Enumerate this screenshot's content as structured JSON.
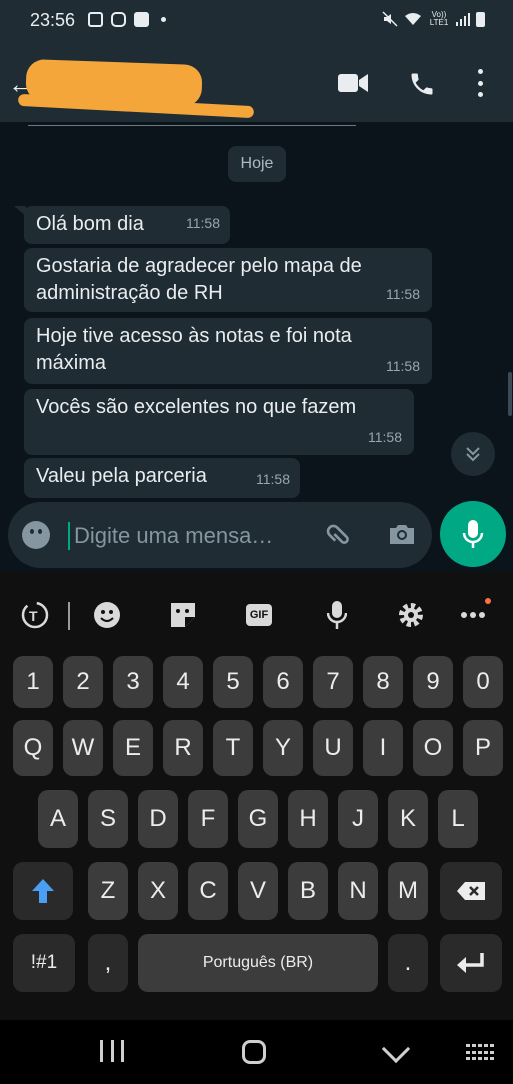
{
  "status_bar": {
    "time": "23:56",
    "network_label": "Vo)) LTE1"
  },
  "app_bar": {
    "contact_name": "",
    "icons": [
      "back-arrow-icon",
      "video-call-icon",
      "phone-call-icon",
      "more-vert-icon"
    ]
  },
  "chat": {
    "date_label": "Hoje",
    "messages": [
      {
        "text": "Olá bom dia",
        "time": "11:58"
      },
      {
        "text": "Gostaria de agradecer pelo mapa de administração de RH",
        "time": "11:58"
      },
      {
        "text": "Hoje tive acesso às notas e foi nota máxima",
        "time": "11:58"
      },
      {
        "text": "Vocês são excelentes no que fazem",
        "time": "11:58"
      },
      {
        "text": "Valeu pela parceria",
        "time": "11:58"
      }
    ]
  },
  "composer": {
    "placeholder": "Digite uma mensa…"
  },
  "keyboard": {
    "number_row": [
      "1",
      "2",
      "3",
      "4",
      "5",
      "6",
      "7",
      "8",
      "9",
      "0"
    ],
    "row1": [
      "Q",
      "W",
      "E",
      "R",
      "T",
      "Y",
      "U",
      "I",
      "O",
      "P"
    ],
    "row2": [
      "A",
      "S",
      "D",
      "F",
      "G",
      "H",
      "J",
      "K",
      "L"
    ],
    "row3": [
      "Z",
      "X",
      "C",
      "V",
      "B",
      "N",
      "M"
    ],
    "symbols_label": "!#1",
    "comma_label": ",",
    "space_label": "Português (BR)",
    "period_label": ".",
    "gif_label": "GIF"
  },
  "colors": {
    "accent": "#00a884",
    "bubble": "#1f2c34",
    "header": "#1f2c34",
    "shift_arrow": "#4a9ff5"
  }
}
